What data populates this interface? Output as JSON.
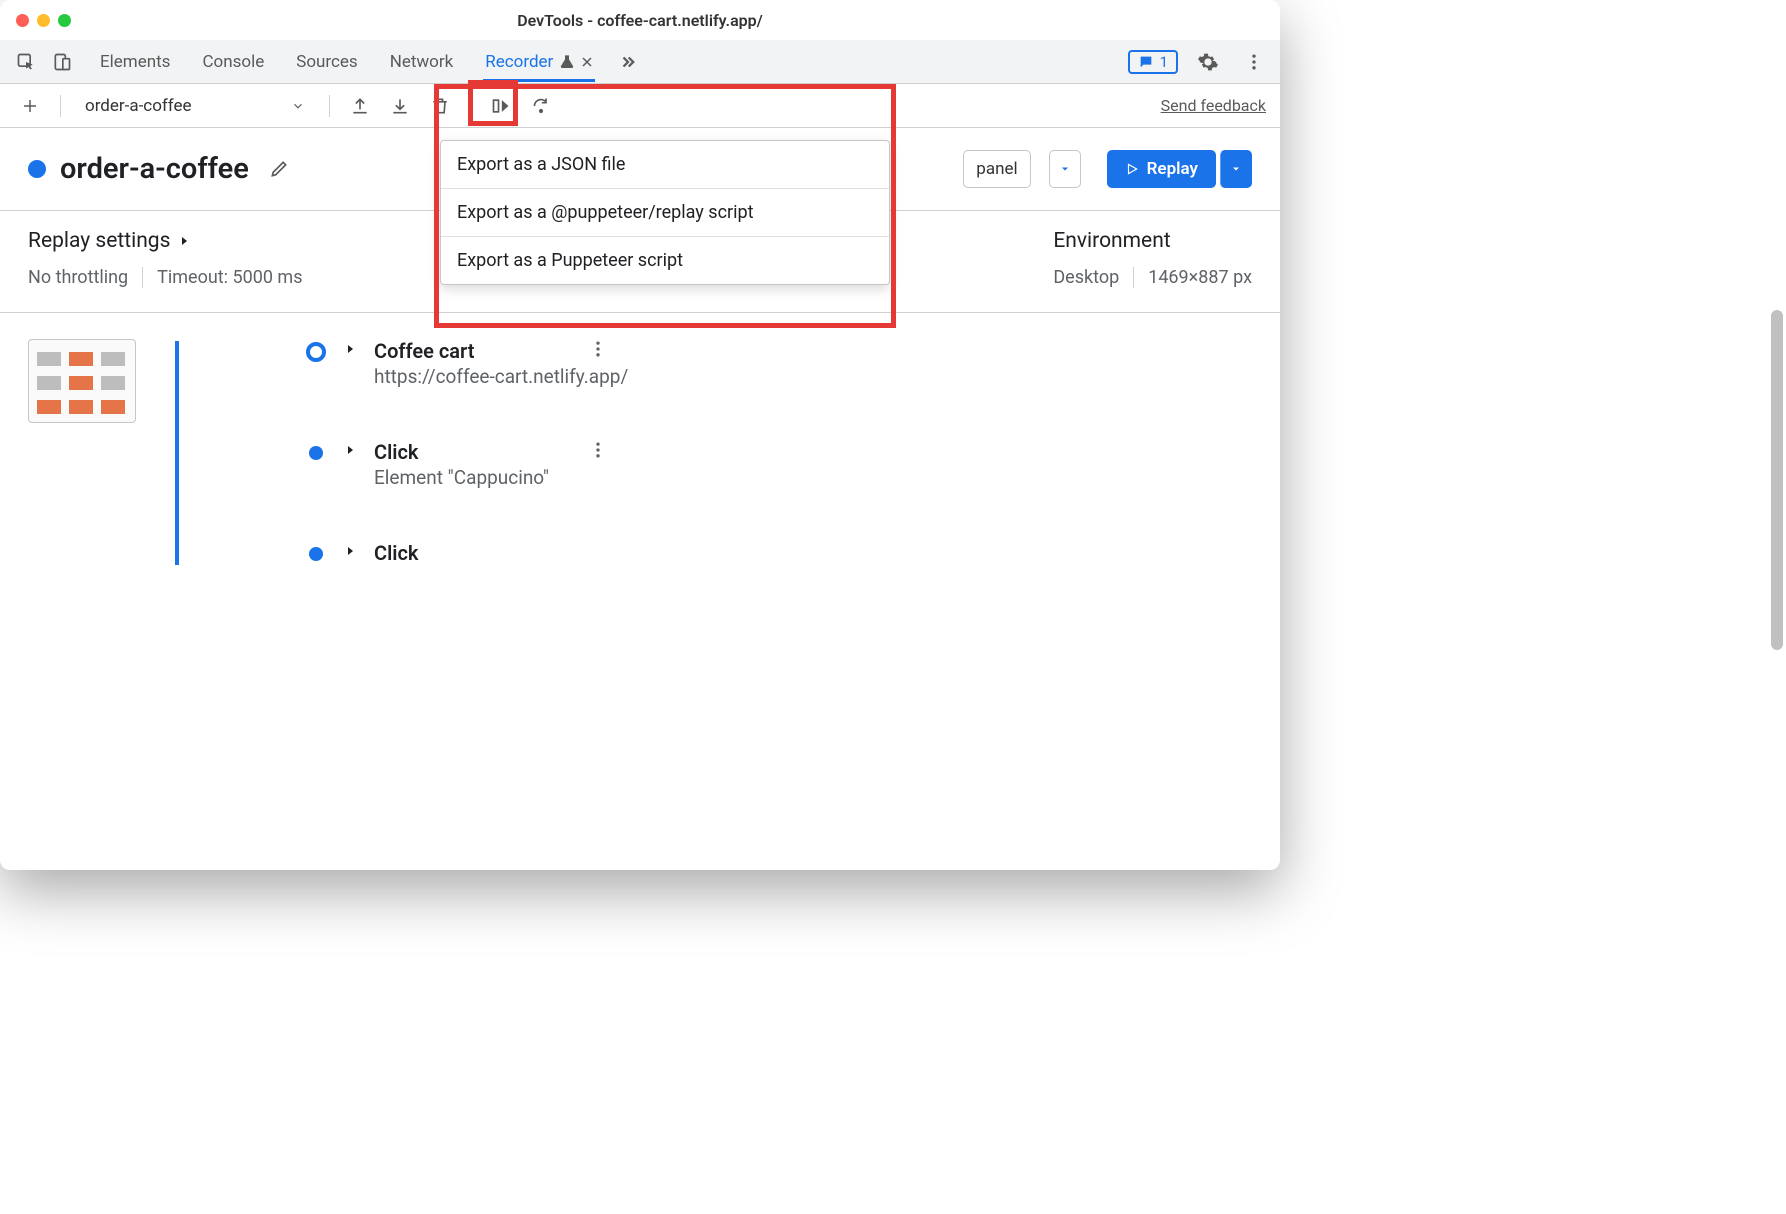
{
  "window": {
    "title": "DevTools - coffee-cart.netlify.app/"
  },
  "tabs": {
    "items": [
      "Elements",
      "Console",
      "Sources",
      "Network",
      "Recorder"
    ],
    "active": "Recorder",
    "issues_count": "1"
  },
  "toolbar": {
    "recording_name": "order-a-coffee",
    "feedback": "Send feedback"
  },
  "recording": {
    "title": "order-a-coffee",
    "panel_label": "panel",
    "replay_label": "Replay"
  },
  "export_menu": {
    "items": [
      "Export as a JSON file",
      "Export as a @puppeteer/replay script",
      "Export as a Puppeteer script"
    ]
  },
  "settings": {
    "replay_heading": "Replay settings",
    "throttling": "No throttling",
    "timeout": "Timeout: 5000 ms",
    "env_heading": "Environment",
    "device": "Desktop",
    "viewport": "1469×887 px"
  },
  "steps": [
    {
      "title": "Coffee cart",
      "subtitle": "https://coffee-cart.netlify.app/",
      "first": true
    },
    {
      "title": "Click",
      "subtitle": "Element \"Cappucino\""
    },
    {
      "title": "Click",
      "subtitle": ""
    }
  ]
}
